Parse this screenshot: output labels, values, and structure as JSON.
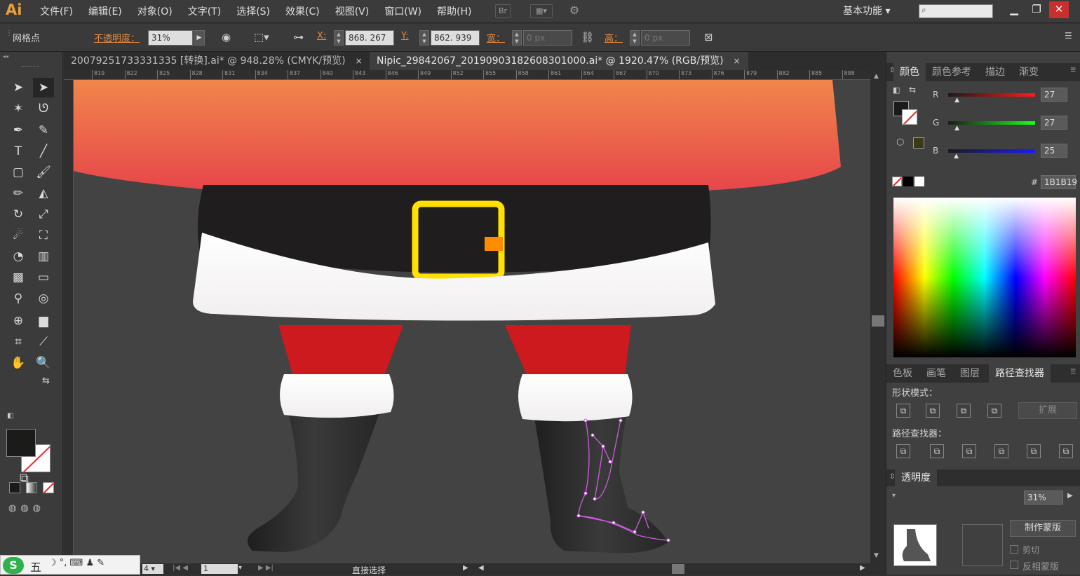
{
  "app": {
    "logo": "Ai"
  },
  "menu": [
    "文件(F)",
    "编辑(E)",
    "对象(O)",
    "文字(T)",
    "选择(S)",
    "效果(C)",
    "视图(V)",
    "窗口(W)",
    "帮助(H)"
  ],
  "menubar_icons": {
    "bridge": "Br"
  },
  "workspace": "基本功能",
  "control": {
    "selection_label": "网格点",
    "opacity_label": "不透明度：",
    "opacity_value": "31%",
    "x_label": "X:",
    "x_value": "868. 267",
    "y_label": "Y:",
    "y_value": "862. 939",
    "w_label": "宽：",
    "w_value": "0 px",
    "h_label": "高：",
    "h_value": "0 px"
  },
  "tabs": [
    {
      "label": "20079251733331335 [转换].ai* @ 948.28% (CMYK/预览)",
      "close": "×"
    },
    {
      "label": "Nipic_29842067_20190903182608301000.ai* @ 1920.47% (RGB/预览)",
      "close": "×"
    }
  ],
  "ruler_ticks": [
    "819",
    "822",
    "825",
    "828",
    "831",
    "834",
    "837",
    "840",
    "843",
    "846",
    "849",
    "852",
    "855",
    "858",
    "861",
    "864",
    "867",
    "870",
    "873",
    "876",
    "879",
    "882",
    "885",
    "888"
  ],
  "color_panel": {
    "tabs": [
      "颜色",
      "颜色参考",
      "描边",
      "渐变"
    ],
    "channels": [
      {
        "name": "R",
        "value": "27",
        "pct": 0.106
      },
      {
        "name": "G",
        "value": "27",
        "pct": 0.106
      },
      {
        "name": "B",
        "value": "25",
        "pct": 0.098
      }
    ],
    "hex_label": "#",
    "hex": "1B1B19"
  },
  "pathfinder": {
    "tabs": [
      "色板",
      "画笔",
      "图层",
      "路径查找器"
    ],
    "shape_modes_label": "形状模式：",
    "pathfinders_label": "路径查找器：",
    "expand_label": "扩展"
  },
  "transparency": {
    "title": "透明度",
    "opacity": "31%",
    "make_mask": "制作蒙版",
    "clip": "剪切",
    "invert_mask": "反相蒙版"
  },
  "status": {
    "zoom": "4",
    "artboard": "1",
    "tool": "直接选择"
  },
  "ime": {
    "label": "五"
  },
  "colors": {
    "coat_top": "#f0864a",
    "coat_bottom": "#e63f4a",
    "belt": "#1f1d1d",
    "buckle": "#ffe000",
    "fur": "#ffffff",
    "pants": "#cc1a1e",
    "boot": "#2b2b2b",
    "path_highlight": "#d05ae0",
    "fill": "#1b1b19"
  }
}
